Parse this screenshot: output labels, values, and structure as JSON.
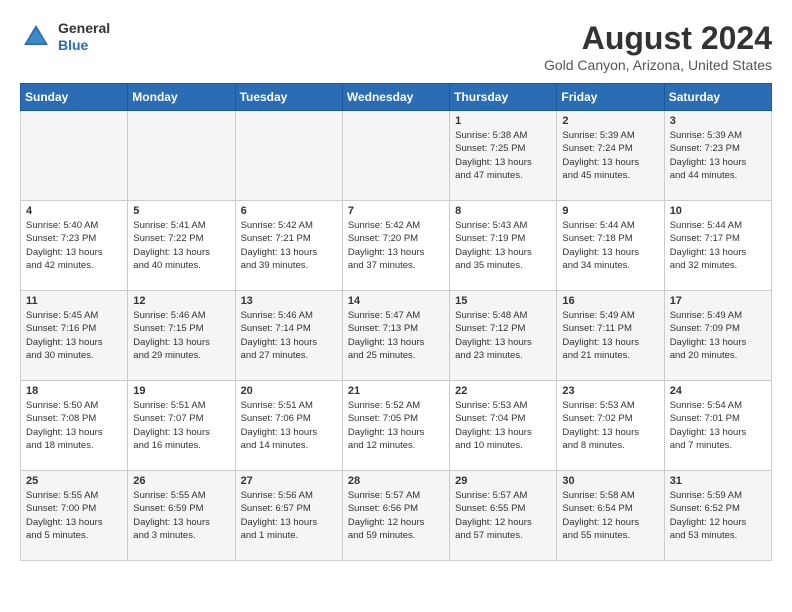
{
  "header": {
    "logo_line1": "General",
    "logo_line2": "Blue",
    "month_year": "August 2024",
    "location": "Gold Canyon, Arizona, United States"
  },
  "weekdays": [
    "Sunday",
    "Monday",
    "Tuesday",
    "Wednesday",
    "Thursday",
    "Friday",
    "Saturday"
  ],
  "weeks": [
    [
      {
        "day": "",
        "info": ""
      },
      {
        "day": "",
        "info": ""
      },
      {
        "day": "",
        "info": ""
      },
      {
        "day": "",
        "info": ""
      },
      {
        "day": "1",
        "info": "Sunrise: 5:38 AM\nSunset: 7:25 PM\nDaylight: 13 hours\nand 47 minutes."
      },
      {
        "day": "2",
        "info": "Sunrise: 5:39 AM\nSunset: 7:24 PM\nDaylight: 13 hours\nand 45 minutes."
      },
      {
        "day": "3",
        "info": "Sunrise: 5:39 AM\nSunset: 7:23 PM\nDaylight: 13 hours\nand 44 minutes."
      }
    ],
    [
      {
        "day": "4",
        "info": "Sunrise: 5:40 AM\nSunset: 7:23 PM\nDaylight: 13 hours\nand 42 minutes."
      },
      {
        "day": "5",
        "info": "Sunrise: 5:41 AM\nSunset: 7:22 PM\nDaylight: 13 hours\nand 40 minutes."
      },
      {
        "day": "6",
        "info": "Sunrise: 5:42 AM\nSunset: 7:21 PM\nDaylight: 13 hours\nand 39 minutes."
      },
      {
        "day": "7",
        "info": "Sunrise: 5:42 AM\nSunset: 7:20 PM\nDaylight: 13 hours\nand 37 minutes."
      },
      {
        "day": "8",
        "info": "Sunrise: 5:43 AM\nSunset: 7:19 PM\nDaylight: 13 hours\nand 35 minutes."
      },
      {
        "day": "9",
        "info": "Sunrise: 5:44 AM\nSunset: 7:18 PM\nDaylight: 13 hours\nand 34 minutes."
      },
      {
        "day": "10",
        "info": "Sunrise: 5:44 AM\nSunset: 7:17 PM\nDaylight: 13 hours\nand 32 minutes."
      }
    ],
    [
      {
        "day": "11",
        "info": "Sunrise: 5:45 AM\nSunset: 7:16 PM\nDaylight: 13 hours\nand 30 minutes."
      },
      {
        "day": "12",
        "info": "Sunrise: 5:46 AM\nSunset: 7:15 PM\nDaylight: 13 hours\nand 29 minutes."
      },
      {
        "day": "13",
        "info": "Sunrise: 5:46 AM\nSunset: 7:14 PM\nDaylight: 13 hours\nand 27 minutes."
      },
      {
        "day": "14",
        "info": "Sunrise: 5:47 AM\nSunset: 7:13 PM\nDaylight: 13 hours\nand 25 minutes."
      },
      {
        "day": "15",
        "info": "Sunrise: 5:48 AM\nSunset: 7:12 PM\nDaylight: 13 hours\nand 23 minutes."
      },
      {
        "day": "16",
        "info": "Sunrise: 5:49 AM\nSunset: 7:11 PM\nDaylight: 13 hours\nand 21 minutes."
      },
      {
        "day": "17",
        "info": "Sunrise: 5:49 AM\nSunset: 7:09 PM\nDaylight: 13 hours\nand 20 minutes."
      }
    ],
    [
      {
        "day": "18",
        "info": "Sunrise: 5:50 AM\nSunset: 7:08 PM\nDaylight: 13 hours\nand 18 minutes."
      },
      {
        "day": "19",
        "info": "Sunrise: 5:51 AM\nSunset: 7:07 PM\nDaylight: 13 hours\nand 16 minutes."
      },
      {
        "day": "20",
        "info": "Sunrise: 5:51 AM\nSunset: 7:06 PM\nDaylight: 13 hours\nand 14 minutes."
      },
      {
        "day": "21",
        "info": "Sunrise: 5:52 AM\nSunset: 7:05 PM\nDaylight: 13 hours\nand 12 minutes."
      },
      {
        "day": "22",
        "info": "Sunrise: 5:53 AM\nSunset: 7:04 PM\nDaylight: 13 hours\nand 10 minutes."
      },
      {
        "day": "23",
        "info": "Sunrise: 5:53 AM\nSunset: 7:02 PM\nDaylight: 13 hours\nand 8 minutes."
      },
      {
        "day": "24",
        "info": "Sunrise: 5:54 AM\nSunset: 7:01 PM\nDaylight: 13 hours\nand 7 minutes."
      }
    ],
    [
      {
        "day": "25",
        "info": "Sunrise: 5:55 AM\nSunset: 7:00 PM\nDaylight: 13 hours\nand 5 minutes."
      },
      {
        "day": "26",
        "info": "Sunrise: 5:55 AM\nSunset: 6:59 PM\nDaylight: 13 hours\nand 3 minutes."
      },
      {
        "day": "27",
        "info": "Sunrise: 5:56 AM\nSunset: 6:57 PM\nDaylight: 13 hours\nand 1 minute."
      },
      {
        "day": "28",
        "info": "Sunrise: 5:57 AM\nSunset: 6:56 PM\nDaylight: 12 hours\nand 59 minutes."
      },
      {
        "day": "29",
        "info": "Sunrise: 5:57 AM\nSunset: 6:55 PM\nDaylight: 12 hours\nand 57 minutes."
      },
      {
        "day": "30",
        "info": "Sunrise: 5:58 AM\nSunset: 6:54 PM\nDaylight: 12 hours\nand 55 minutes."
      },
      {
        "day": "31",
        "info": "Sunrise: 5:59 AM\nSunset: 6:52 PM\nDaylight: 12 hours\nand 53 minutes."
      }
    ]
  ]
}
